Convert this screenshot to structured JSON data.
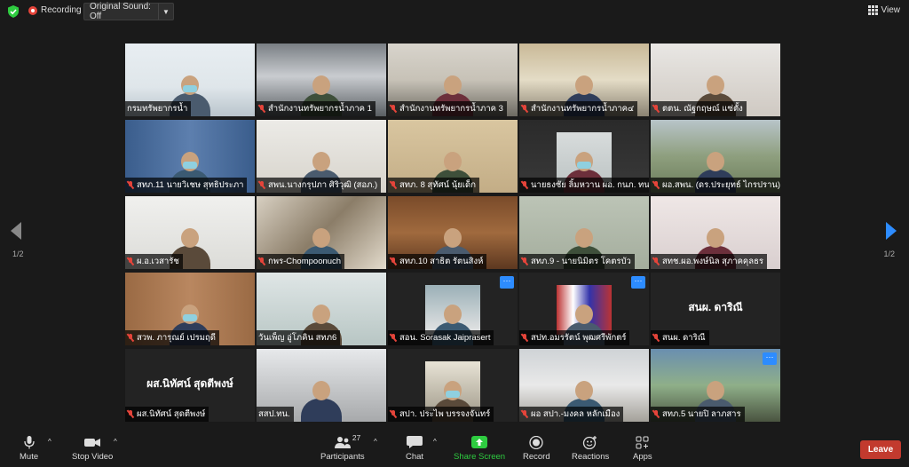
{
  "topbar": {
    "recording_label": "Recording",
    "original_sound_label": "Original Sound: Off",
    "view_label": "View",
    "shield_color": "#2ecc40",
    "recording_color": "#e5443a"
  },
  "pagination": {
    "left": "1/2",
    "right": "1/2"
  },
  "tiles": [
    {
      "name": "กรมทรัพยากรน้ำ",
      "muted": false,
      "scene": "office-blue",
      "active": true
    },
    {
      "name": "สำนักงานทรัพยากรน้ำภาค 1",
      "muted": true,
      "scene": "hall"
    },
    {
      "name": "สำนักงานทรัพยากรน้ำภาค 3",
      "muted": true,
      "scene": "meeting-room"
    },
    {
      "name": "สำนักงานทรัพยากรน้ำภาค๔",
      "muted": true,
      "scene": "meeting-room2"
    },
    {
      "name": "ตตน. ณัฐกฤษณ์ แซ่ตั้ง",
      "muted": true,
      "scene": "closeup"
    },
    {
      "name": "สทภ.11 นายวิเชษ สุทธิประภา",
      "muted": true,
      "scene": "curtain"
    },
    {
      "name": "สพน.นางกรุปภา ศิริวุฒิ (สอภ.)",
      "muted": true,
      "scene": "office-light"
    },
    {
      "name": "สทภ. 8 สุทัศน์ นุ้ยเด็ก",
      "muted": true,
      "scene": "office-warm"
    },
    {
      "name": "นายธงชัย ลิ้มหวาน ผอ. กนภ. ทน",
      "muted": true,
      "scene": "dark"
    },
    {
      "name": "ผอ.สพน. (ดร.ประยุทธ์ ไกรปราน)",
      "muted": true,
      "scene": "landscape"
    },
    {
      "name": "ผ.อ.เวสารัช",
      "muted": true,
      "scene": "white-wall"
    },
    {
      "name": "กพร-Chompoonuch",
      "muted": true,
      "scene": "art"
    },
    {
      "name": "สทภ.10 สาธิต รัตนสิงห์",
      "muted": true,
      "scene": "wood"
    },
    {
      "name": "สทภ.9 - นายนิมิตร โคตรบัว",
      "muted": true,
      "scene": "green-wall"
    },
    {
      "name": "สทช.ผอ.พงษ์นิล สุภาคคุลธร",
      "muted": true,
      "scene": "pink"
    },
    {
      "name": "สวพ. ภารุณย์ เปรมฤดี",
      "muted": true,
      "scene": "wood2"
    },
    {
      "name": "วันเพ็ญ อู่โภคิน สทภ6",
      "muted": false,
      "scene": "office-light2"
    },
    {
      "name": "สอน. Sorasak Jaiprasert",
      "muted": true,
      "scene": "portrait",
      "more": true
    },
    {
      "name": "สปท.อมรรัตน์ พุฒศรีพักตร์",
      "muted": true,
      "scene": "flags",
      "more": true
    },
    {
      "name": "สนผ. ดาริณี",
      "muted": true,
      "scene": "name-only",
      "display": "สนผ. ดาริณี"
    },
    {
      "name": "ผส.นิทัศน์ สุดตีพงษ์",
      "muted": true,
      "scene": "name-only",
      "display": "ผส.นิทัศน์ สุดตีพงษ์"
    },
    {
      "name": "สสป.ทน.",
      "muted": false,
      "scene": "window-room"
    },
    {
      "name": "สปา. ประไพ บรรจงจันทร์",
      "muted": true,
      "scene": "shelf"
    },
    {
      "name": "ผอ สปา.-มงคล หลักเมือง",
      "muted": true,
      "scene": "ceiling"
    },
    {
      "name": "สทภ.5 นายปิ ลาภสาร",
      "muted": true,
      "scene": "poster",
      "more": true
    }
  ],
  "more_label": "···",
  "toolbar": {
    "mute_label": "Mute",
    "video_label": "Stop Video",
    "participants_label": "Participants",
    "participants_count": "27",
    "chat_label": "Chat",
    "share_label": "Share Screen",
    "record_label": "Record",
    "reactions_label": "Reactions",
    "apps_label": "Apps",
    "leave_label": "Leave",
    "share_color": "#2ecc40",
    "leave_color": "#c23a2e"
  }
}
